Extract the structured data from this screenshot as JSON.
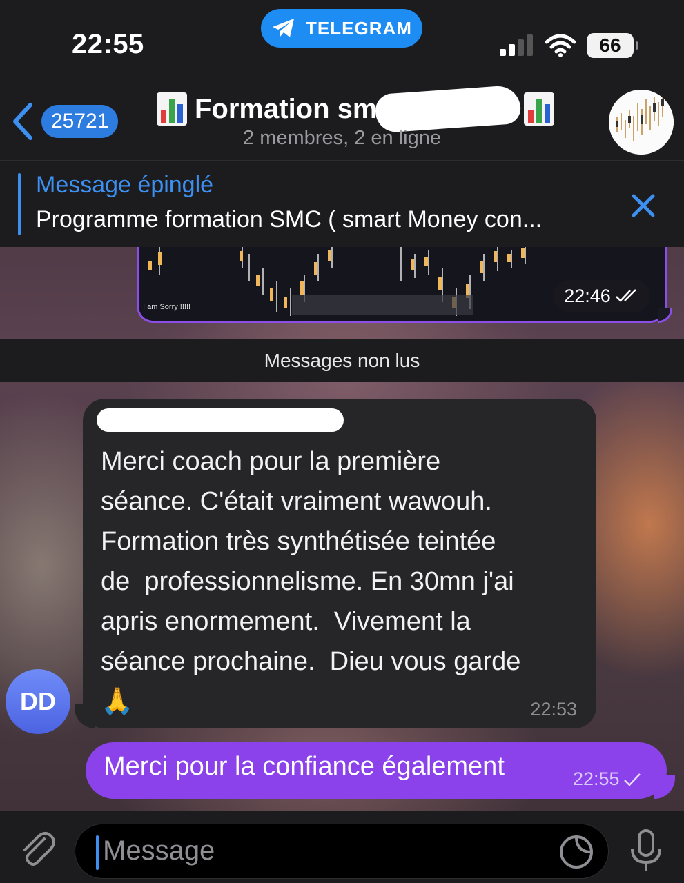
{
  "status_bar": {
    "time": "22:55",
    "app_pill": "TELEGRAM",
    "battery": "66"
  },
  "header": {
    "back_count": "25721",
    "title": "Formation sm",
    "subtitle": "2 membres, 2 en ligne"
  },
  "pinned": {
    "label": "Message épinglé",
    "text": "Programme formation SMC ( smart Money con..."
  },
  "image_message": {
    "caption_in_image": "I am Sorry !!!!!",
    "time": "22:46"
  },
  "unread_divider": "Messages non lus",
  "incoming_message": {
    "avatar_initials": "DD",
    "text": "Merci coach pour la première\nséance. C'était vraiment wawouh.\nFormation très synthétisée teintée\nde  professionnelisme. En 30mn j'ai\napris enormement.  Vivement la\nséance prochaine.  Dieu vous garde\n🙏",
    "time": "22:53"
  },
  "outgoing_message": {
    "text": "Merci pour la confiance également",
    "time": "22:55"
  },
  "composer": {
    "placeholder": "Message"
  },
  "colors": {
    "accent": "#3d8ff0",
    "outgoing_bubble": "#8b42ea",
    "telegram_pill": "#1d8cf3"
  }
}
